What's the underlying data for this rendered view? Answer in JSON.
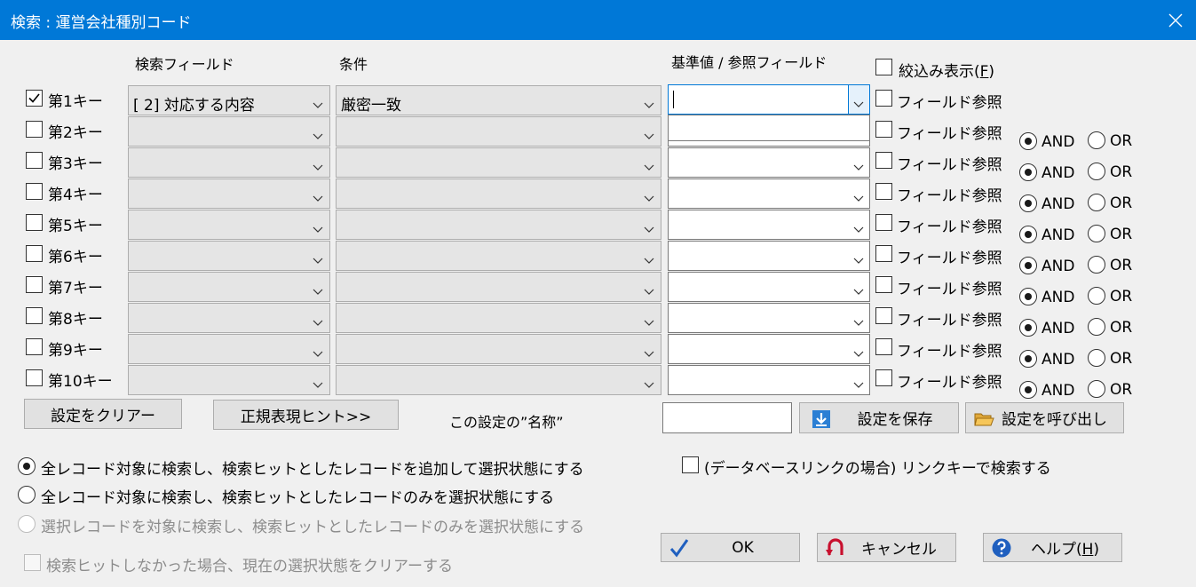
{
  "window": {
    "title": "検索 : 運営会社種別コード"
  },
  "headers": {
    "field": "検索フィールド",
    "condition": "条件",
    "value": "基準値 / 参照フィールド"
  },
  "narrow_display": {
    "label": "絞込み表示(F)",
    "checked": false
  },
  "rows": [
    {
      "key_label": "第1キー",
      "checked": true,
      "field": "[ 2] 対応する内容",
      "condition": "厳密一致",
      "value": "",
      "field_ref": "フィールド参照"
    },
    {
      "key_label": "第2キー",
      "checked": false,
      "field": "",
      "condition": "",
      "value": "",
      "field_ref": "フィールド参照",
      "logic": "AND"
    },
    {
      "key_label": "第3キー",
      "checked": false,
      "field": "",
      "condition": "",
      "value": "",
      "field_ref": "フィールド参照",
      "logic": "AND"
    },
    {
      "key_label": "第4キー",
      "checked": false,
      "field": "",
      "condition": "",
      "value": "",
      "field_ref": "フィールド参照",
      "logic": "AND"
    },
    {
      "key_label": "第5キー",
      "checked": false,
      "field": "",
      "condition": "",
      "value": "",
      "field_ref": "フィールド参照",
      "logic": "AND"
    },
    {
      "key_label": "第6キー",
      "checked": false,
      "field": "",
      "condition": "",
      "value": "",
      "field_ref": "フィールド参照",
      "logic": "AND"
    },
    {
      "key_label": "第7キー",
      "checked": false,
      "field": "",
      "condition": "",
      "value": "",
      "field_ref": "フィールド参照",
      "logic": "AND"
    },
    {
      "key_label": "第8キー",
      "checked": false,
      "field": "",
      "condition": "",
      "value": "",
      "field_ref": "フィールド参照",
      "logic": "AND"
    },
    {
      "key_label": "第9キー",
      "checked": false,
      "field": "",
      "condition": "",
      "value": "",
      "field_ref": "フィールド参照",
      "logic": "AND"
    },
    {
      "key_label": "第10キー",
      "checked": false,
      "field": "",
      "condition": "",
      "value": "",
      "field_ref": "フィールド参照",
      "logic": "AND"
    }
  ],
  "logic_options": {
    "and": "AND",
    "or": "OR"
  },
  "buttons": {
    "clear": "設定をクリアー",
    "regex_hint": "正規表現ヒント>>",
    "save": "設定を保存",
    "load": "設定を呼び出し",
    "ok": "OK",
    "cancel": "キャンセル",
    "help": "ヘルプ(H)"
  },
  "setting_name": {
    "label": "この設定の”名称”",
    "value": ""
  },
  "options": {
    "mode1": "全レコード対象に検索し、検索ヒットとしたレコードを追加して選択状態にする",
    "mode2": "全レコード対象に検索し、検索ヒットとしたレコードのみを選択状態にする",
    "mode3": "選択レコードを対象に検索し、検索ヒットとしたレコードのみを選択状態にする",
    "clear_if_no_hit": "検索ヒットしなかった場合、現在の選択状態をクリアーする",
    "db_link": "(データベースリンクの場合) リンクキーで検索する",
    "selected_mode": "mode1"
  },
  "colors": {
    "titlebar": "#0078d7",
    "background": "#f0f0f0",
    "focus": "#0078d7"
  }
}
